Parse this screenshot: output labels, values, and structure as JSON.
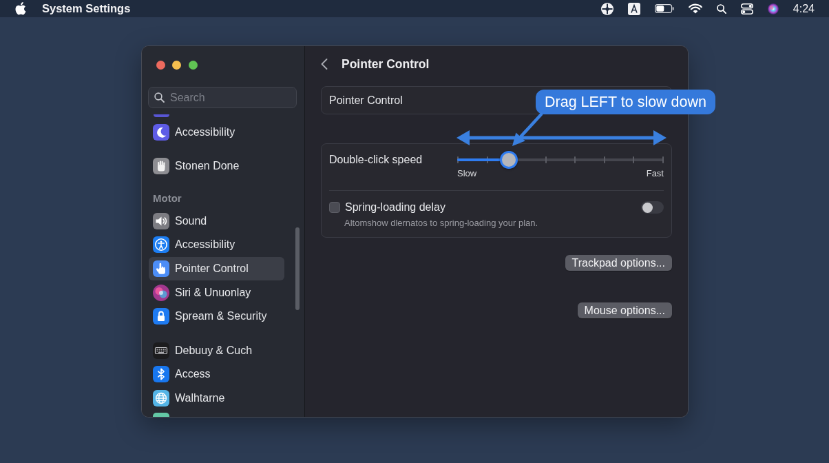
{
  "menu_bar": {
    "app_name": "System Settings",
    "clock": "4:24"
  },
  "sidebar": {
    "search": {
      "placeholder": "Search"
    },
    "sections": [
      {
        "items": [
          {
            "label": "Accessibility",
            "color": "#5e5ce6",
            "selected": false
          }
        ]
      },
      {
        "items": [
          {
            "label": "Stonen Done",
            "color": "#8e8e93",
            "selected": false
          }
        ]
      },
      {
        "header": "Motor",
        "items": [
          {
            "label": "Sound",
            "color": "#7c7c82",
            "selected": false
          },
          {
            "label": "Accessibility",
            "color": "#1c7df2",
            "selected": false
          },
          {
            "label": "Pointer Control",
            "color": "#4c8df6",
            "selected": true
          },
          {
            "label": "Siri & Unuonlay",
            "color": "#a2388f",
            "selected": false
          },
          {
            "label": "Spream & Security",
            "color": "#1f7bf2",
            "selected": false
          }
        ]
      },
      {
        "items": [
          {
            "label": "Debuuy & Cuch",
            "color": "#1c1c1e",
            "selected": false
          },
          {
            "label": "Access",
            "color": "#1877f0",
            "selected": false
          },
          {
            "label": "Walhtarne",
            "color": "#54b4e6",
            "selected": false
          }
        ]
      }
    ]
  },
  "detail": {
    "title": "Pointer Control",
    "groups": [
      {
        "rows": [
          {
            "kind": "label",
            "label": "Pointer Control"
          }
        ]
      },
      {
        "rows": [
          {
            "kind": "slider",
            "label": "Double-click speed",
            "level": 0.25,
            "min_label": "Slow",
            "max_label": "Fast"
          },
          {
            "kind": "toggle",
            "label": "Spring-loading delay",
            "description": "Altomshow dlernatos to spring-loading your plan.",
            "checked": false,
            "on": false
          }
        ]
      }
    ],
    "buttons": [
      {
        "label": "Trackpad options..."
      },
      {
        "label": "Mouse options..."
      }
    ]
  },
  "annotation": {
    "text": "Drag LEFT to slow down"
  }
}
